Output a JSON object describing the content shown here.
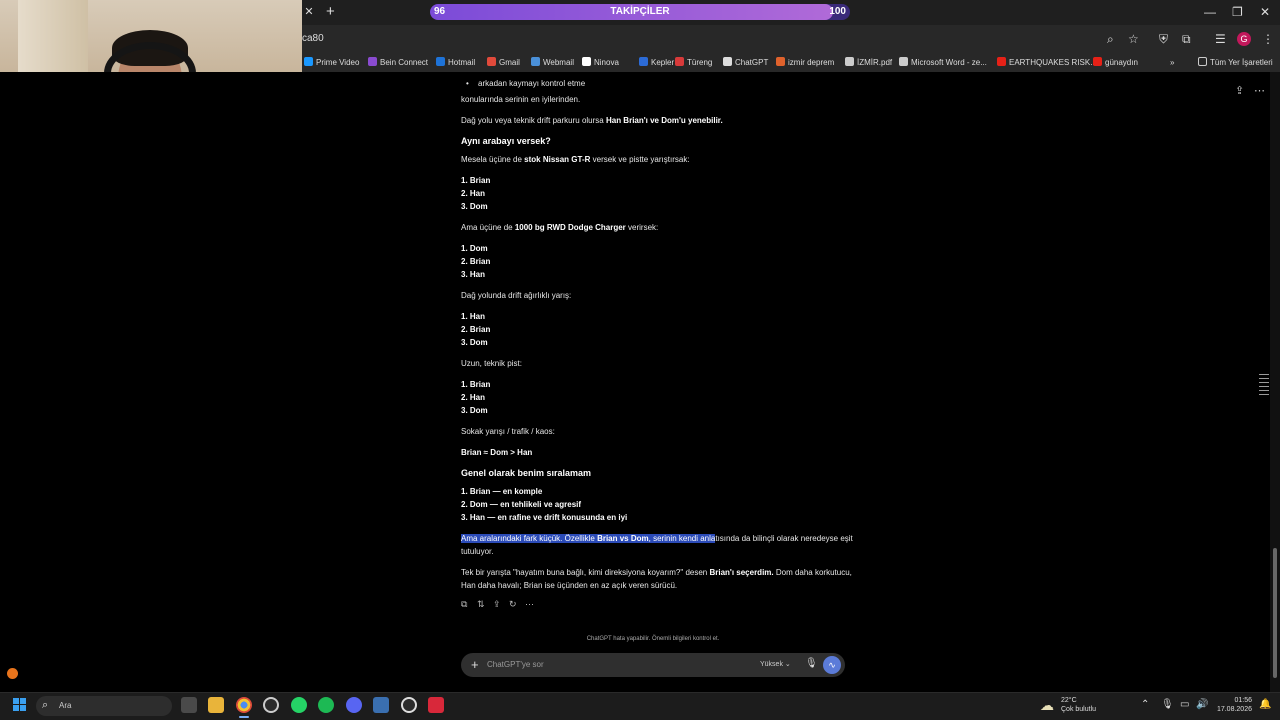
{
  "browser": {
    "address_partial": "ca80",
    "new_tab_symbol": "+",
    "profile_letter": "G",
    "bookmarks": [
      {
        "label": "Prime Video",
        "icon": "prime-video-icon",
        "color": "#1a98ff"
      },
      {
        "label": "Bein Connect",
        "icon": "bein-icon",
        "color": "#8a4bd0"
      },
      {
        "label": "Hotmail",
        "icon": "outlook-icon",
        "color": "#1e73d8"
      },
      {
        "label": "Gmail",
        "icon": "gmail-icon",
        "color": "#e14a3b"
      },
      {
        "label": "Webmail",
        "icon": "webmail-icon",
        "color": "#4a90d9"
      },
      {
        "label": "Ninova",
        "icon": "ninova-icon",
        "color": "#ffffff"
      },
      {
        "label": "Kepler",
        "icon": "kepler-icon",
        "color": "#2c6bd6"
      },
      {
        "label": "Türeng",
        "icon": "tureng-icon",
        "color": "#d83a3a"
      },
      {
        "label": "ChatGPT",
        "icon": "chatgpt-icon",
        "color": "#dddddd"
      },
      {
        "label": "izmir deprem",
        "icon": "deprem-icon",
        "color": "#e0622c"
      },
      {
        "label": "İZMİR.pdf",
        "icon": "pdf-link-icon",
        "color": "#cccccc"
      },
      {
        "label": "Microsoft Word - ze...",
        "icon": "wordpress-icon",
        "color": "#cccccc"
      },
      {
        "label": "EARTHQUAKES RISK...",
        "icon": "youtube-icon",
        "color": "#e62117"
      },
      {
        "label": "günaydın",
        "icon": "youtube-icon",
        "color": "#e62117"
      }
    ],
    "all_bookmarks": "Tüm Yer İşaretleri"
  },
  "follower_goal": {
    "label": "TAKİPÇİLER",
    "current": "96",
    "target": "100",
    "progress": 0.96
  },
  "chat": {
    "bullet_item": "arkadan kaymayı kontrol etme",
    "line1": "konularında serinin en iyilerinden.",
    "line2_pre": "Dağ yolu veya teknik drift parkuru olursa ",
    "line2_bold": "Han Brian'ı ve Dom'u yenebilir.",
    "heading1": "Aynı arabayı versek?",
    "line3_pre": "Mesela üçüne de ",
    "line3_bold": "stok Nissan GT-R",
    "line3_post": " versek ve pistte yarıştırsak:",
    "list1": [
      "1. Brian",
      "2. Han",
      "3. Dom"
    ],
    "line4_pre": "Ama üçüne de ",
    "line4_bold": "1000 bg RWD Dodge Charger",
    "line4_post": " verirsek:",
    "list2": [
      "1. Dom",
      "2. Brian",
      "3. Han"
    ],
    "line5": "Dağ yolunda drift ağırlıklı yarış:",
    "list3": [
      "1. Han",
      "2. Brian",
      "3. Dom"
    ],
    "line6": "Uzun, teknik pist:",
    "list4": [
      "1. Brian",
      "2. Han",
      "3. Dom"
    ],
    "line7": "Sokak yarışı / trafik / kaos:",
    "line8": "Brian ≈ Dom > Han",
    "heading2": "Genel olarak benim sıralamam",
    "list5": [
      "1. Brian — en komple",
      "2. Dom — en tehlikeli ve agresif",
      "3. Han — en rafine ve drift konusunda en iyi"
    ],
    "para1_sel_a": "Ama aralarındaki fark küçük. Özellikle ",
    "para1_sel_bold": "Brian vs Dom",
    "para1_sel_b": ", serinin kendi anla",
    "para1_rest": "tısında da bilinçli olarak neredeyse eşit",
    "para1_line2": "tutuluyor.",
    "para2_pre": "Tek bir yarışta \"hayatım buna bağlı, kimi direksiyona koyarım?\" desen ",
    "para2_bold": "Brian'ı seçerdim.",
    "para2_post": " Dom daha korkutucu,",
    "para2_line2": "Han daha havalı; Brian ise üçünden en az açık veren sürücü.",
    "disclaimer": "ChatGPT hata yapabilir. Önemli bilgileri kontrol et.",
    "composer_placeholder": "ChatGPT'ye sor",
    "model_label": "Yüksek"
  },
  "taskbar": {
    "search_label": "Ara",
    "temperature": "22°C",
    "weather_desc": "Çok bulutlu",
    "time": "01:56",
    "date": "17.08.2026"
  }
}
